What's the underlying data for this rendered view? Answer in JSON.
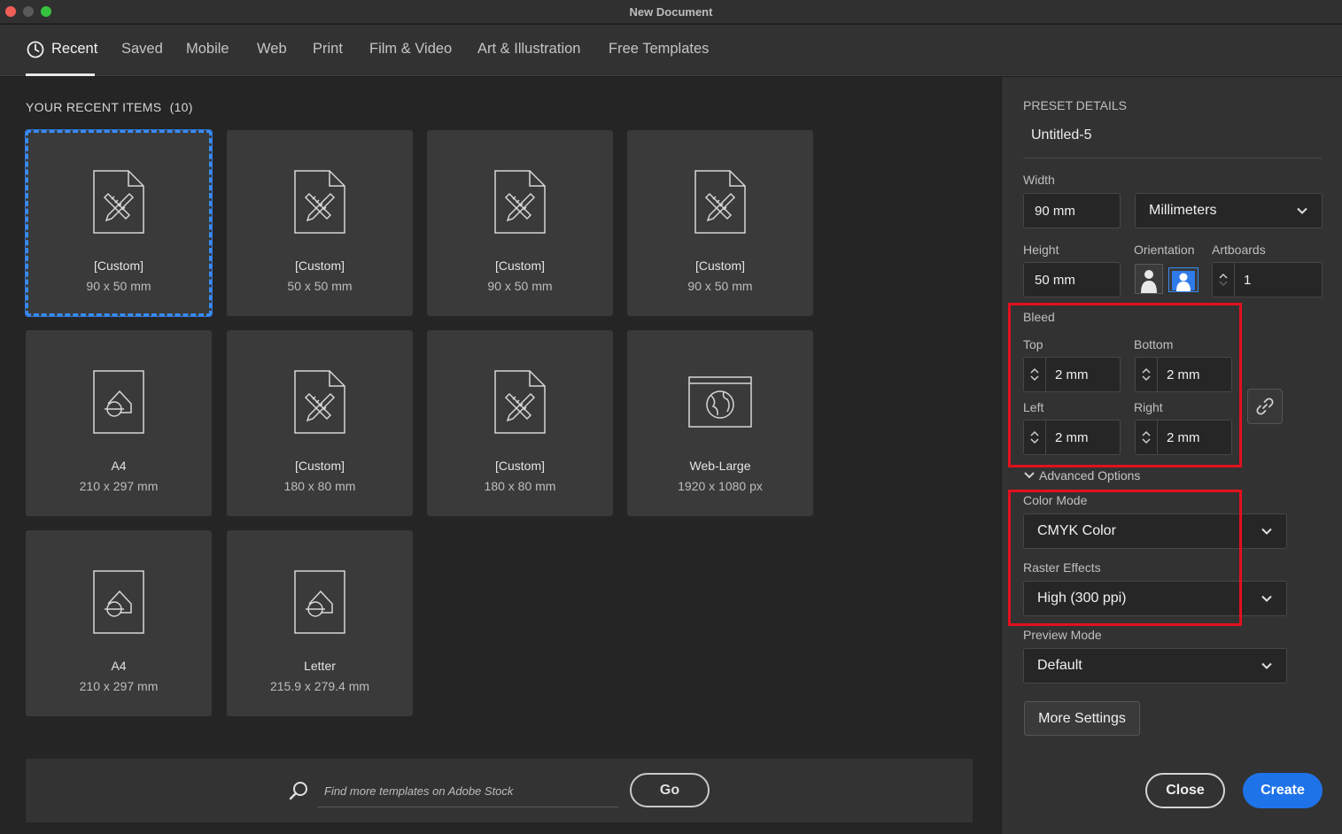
{
  "window": {
    "title": "New Document"
  },
  "tabs": [
    {
      "label": "Recent"
    },
    {
      "label": "Saved"
    },
    {
      "label": "Mobile"
    },
    {
      "label": "Web"
    },
    {
      "label": "Print"
    },
    {
      "label": "Film & Video"
    },
    {
      "label": "Art & Illustration"
    },
    {
      "label": "Free Templates"
    }
  ],
  "recent": {
    "title": "YOUR RECENT ITEMS",
    "count": "(10)",
    "items": [
      {
        "name": "[Custom]",
        "size": "90 x 50 mm",
        "icon": "art-document-icon"
      },
      {
        "name": "[Custom]",
        "size": "50 x 50 mm",
        "icon": "art-document-icon"
      },
      {
        "name": "[Custom]",
        "size": "90 x 50 mm",
        "icon": "art-document-icon"
      },
      {
        "name": "[Custom]",
        "size": "90 x 50 mm",
        "icon": "art-document-icon"
      },
      {
        "name": "A4",
        "size": "210 x 297 mm",
        "icon": "print-document-icon"
      },
      {
        "name": "[Custom]",
        "size": "180 x 80 mm",
        "icon": "art-document-icon"
      },
      {
        "name": "[Custom]",
        "size": "180 x 80 mm",
        "icon": "art-document-icon"
      },
      {
        "name": "Web-Large",
        "size": "1920 x 1080 px",
        "icon": "web-document-icon"
      },
      {
        "name": "A4",
        "size": "210 x 297 mm",
        "icon": "print-document-icon"
      },
      {
        "name": "Letter",
        "size": "215.9 x 279.4 mm",
        "icon": "print-document-icon"
      }
    ]
  },
  "search": {
    "placeholder": "Find more templates on Adobe Stock",
    "go_label": "Go"
  },
  "preset": {
    "section_title": "PRESET DETAILS",
    "name": "Untitled-5",
    "width_label": "Width",
    "width_value": "90 mm",
    "units": "Millimeters",
    "height_label": "Height",
    "height_value": "50 mm",
    "orientation_label": "Orientation",
    "artboards_label": "Artboards",
    "artboards_value": "1",
    "bleed": {
      "label": "Bleed",
      "top_label": "Top",
      "top": "2 mm",
      "bottom_label": "Bottom",
      "bottom": "2 mm",
      "left_label": "Left",
      "left": "2 mm",
      "right_label": "Right",
      "right": "2 mm"
    },
    "advanced_label": "Advanced Options",
    "color_mode_label": "Color Mode",
    "color_mode": "CMYK Color",
    "raster_label": "Raster Effects",
    "raster": "High (300 ppi)",
    "preview_label": "Preview Mode",
    "preview": "Default",
    "more_settings": "More Settings"
  },
  "actions": {
    "close": "Close",
    "create": "Create"
  },
  "colors": {
    "accent": "#1f73e8",
    "selection": "#3a8bf5",
    "highlight": "#e3101e"
  }
}
